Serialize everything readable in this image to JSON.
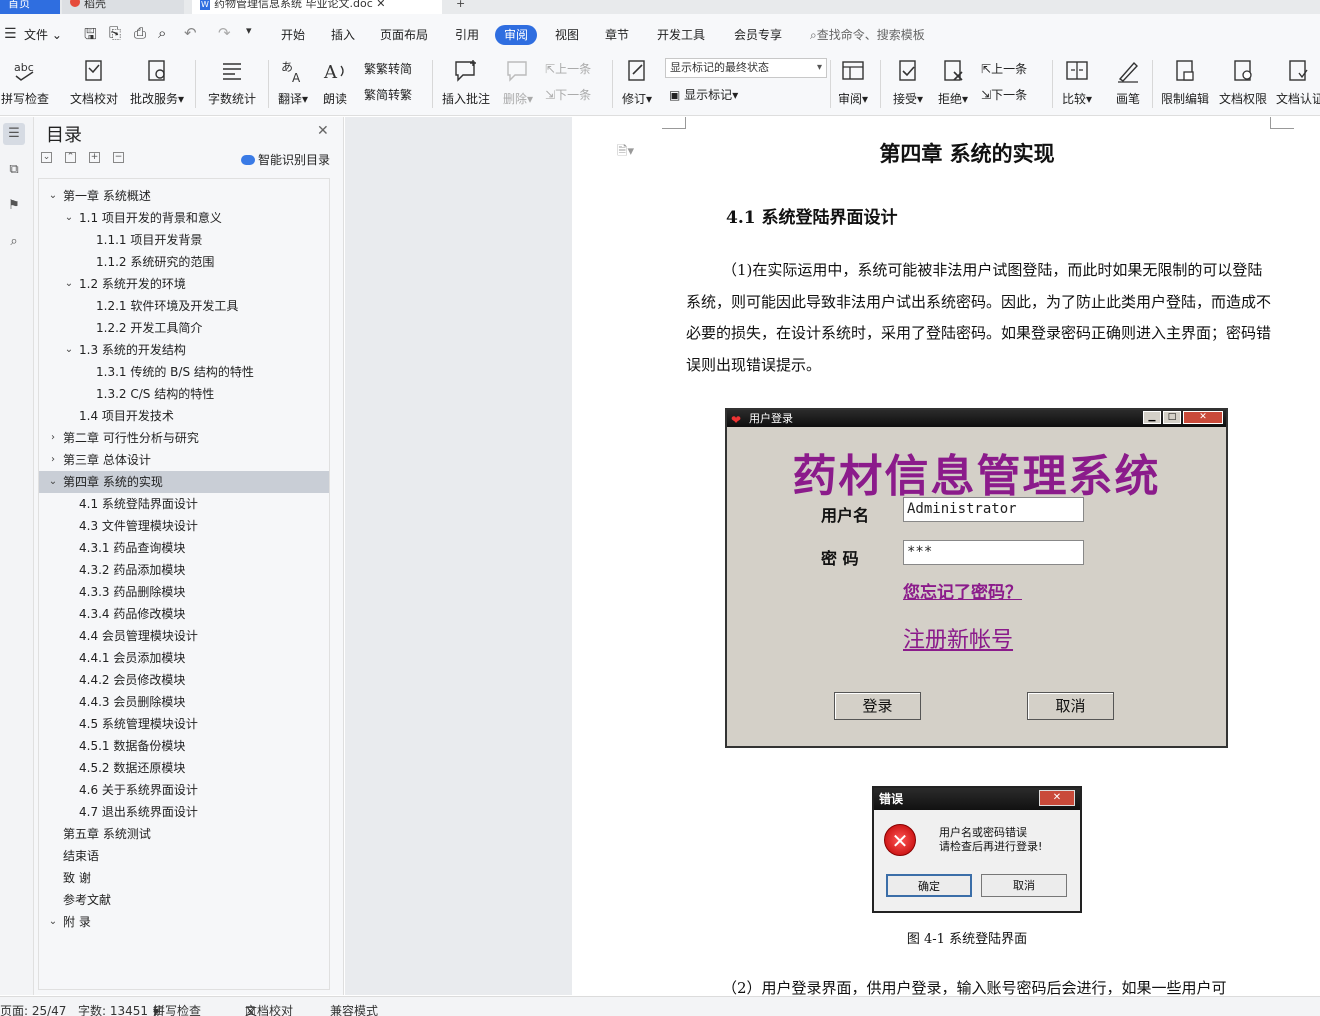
{
  "tabs": {
    "home": "首页",
    "dake": "稻壳",
    "document": "药物管理信息系统 毕业论文.doc"
  },
  "menu": {
    "file": "文件",
    "tabs": [
      "开始",
      "插入",
      "页面布局",
      "引用",
      "审阅",
      "视图",
      "章节",
      "开发工具",
      "会员专享"
    ],
    "active_tab": "审阅",
    "search_placeholder": "查找命令、搜索模板"
  },
  "ribbon": {
    "spell_check": "拼写检查",
    "doc_proof": "文档校对",
    "batch_service": "批改服务",
    "word_count": "字数统计",
    "translate": "翻译",
    "read_aloud": "朗读",
    "trad_to_simp": "繁转简",
    "simp_to_trad": "简转繁",
    "insert_comment": "插入批注",
    "delete": "删除",
    "prev": "上一条",
    "next": "下一条",
    "track_changes": "修订",
    "markup_select": "显示标记的最终状态",
    "show_markup": "显示标记",
    "review": "审阅",
    "accept": "接受",
    "reject": "拒绝",
    "prev_change": "上一条",
    "next_change": "下一条",
    "compare": "比较",
    "pen": "画笔",
    "restrict_edit": "限制编辑",
    "doc_permission": "文档权限",
    "doc_cert": "文档认证"
  },
  "toc": {
    "title": "目录",
    "smart": "智能识别目录",
    "items": [
      {
        "text": "第一章  系统概述",
        "level": 0,
        "arrow": "v"
      },
      {
        "text": "1.1  项目开发的背景和意义",
        "level": 1,
        "arrow": "v"
      },
      {
        "text": "1.1.1  项目开发背景",
        "level": 2,
        "arrow": ""
      },
      {
        "text": "1.1.2  系统研究的范围",
        "level": 2,
        "arrow": ""
      },
      {
        "text": "1.2  系统开发的环境",
        "level": 1,
        "arrow": "v"
      },
      {
        "text": "1.2.1  软件环境及开发工具",
        "level": 2,
        "arrow": ""
      },
      {
        "text": "1.2.2  开发工具简介",
        "level": 2,
        "arrow": ""
      },
      {
        "text": "1.3  系统的开发结构",
        "level": 1,
        "arrow": "v"
      },
      {
        "text": "1.3.1  传统的 B/S 结构的特性",
        "level": 2,
        "arrow": ""
      },
      {
        "text": "1.3.2 C/S  结构的特性",
        "level": 2,
        "arrow": ""
      },
      {
        "text": "1.4  项目开发技术",
        "level": 1,
        "arrow": ""
      },
      {
        "text": "第二章  可行性分析与研究",
        "level": 0,
        "arrow": ">"
      },
      {
        "text": "第三章  总体设计",
        "level": 0,
        "arrow": ">"
      },
      {
        "text": "第四章  系统的实现",
        "level": 0,
        "arrow": "v",
        "selected": true
      },
      {
        "text": "4.1  系统登陆界面设计",
        "level": 1,
        "arrow": ""
      },
      {
        "text": "4.3  文件管理模块设计",
        "level": 1,
        "arrow": ""
      },
      {
        "text": "4.3.1  药品查询模块",
        "level": 1,
        "arrow": ""
      },
      {
        "text": "4.3.2  药品添加模块",
        "level": 1,
        "arrow": ""
      },
      {
        "text": "4.3.3 药品删除模块",
        "level": 1,
        "arrow": ""
      },
      {
        "text": "4.3.4 药品修改模块",
        "level": 1,
        "arrow": ""
      },
      {
        "text": "4.4 会员管理模块设计",
        "level": 1,
        "arrow": ""
      },
      {
        "text": "4.4.1 会员添加模块",
        "level": 1,
        "arrow": ""
      },
      {
        "text": "4.4.2 会员修改模块",
        "level": 1,
        "arrow": ""
      },
      {
        "text": "4.4.3 会员删除模块",
        "level": 1,
        "arrow": ""
      },
      {
        "text": "4.5  系统管理模块设计",
        "level": 1,
        "arrow": ""
      },
      {
        "text": "4.5.1  数据备份模块",
        "level": 1,
        "arrow": ""
      },
      {
        "text": "4.5.2  数据还原模块",
        "level": 1,
        "arrow": ""
      },
      {
        "text": "4.6  关于系统界面设计",
        "level": 1,
        "arrow": ""
      },
      {
        "text": "4.7  退出系统界面设计",
        "level": 1,
        "arrow": ""
      },
      {
        "text": "第五章  系统测试",
        "level": 0,
        "arrow": ""
      },
      {
        "text": "结束语",
        "level": 0,
        "arrow": ""
      },
      {
        "text": "致   谢",
        "level": 0,
        "arrow": ""
      },
      {
        "text": "参考文献",
        "level": 0,
        "arrow": ""
      },
      {
        "text": "附   录",
        "level": 0,
        "arrow": "v"
      }
    ]
  },
  "document": {
    "chapter_title": "第四章  系统的实现",
    "section_title": "4.1  系统登陆界面设计",
    "para1": "（1)在实际运用中，系统可能被非法用户试图登陆，而此时如果无限制的可以登陆系统，则可能因此导致非法用户试出系统密码。因此，为了防止此类用户登陆，而造成不必要的损失，在设计系统时，采用了登陆密码。如果登录密码正确则进入主界面；密码错误则出现错误提示。",
    "para2": "（2）用户登录界面，供用户登录，输入账号密码后会进行，如果一些用户可",
    "caption": "图 4-1  系统登陆界面"
  },
  "login_window": {
    "title": "用户登录",
    "app_title": "药材信息管理系统",
    "username_label": "用户名",
    "username_value": "Administrator",
    "password_label": "密   码",
    "password_value": "***",
    "forgot": "您忘记了密码？",
    "register": "注册新帐号",
    "login_button": "登录",
    "cancel_button": "取消"
  },
  "error_dialog": {
    "title": "错误",
    "line1": "用户名或密码错误",
    "line2": "请检查后再进行登录!",
    "ok": "确定",
    "cancel": "取消"
  },
  "status": {
    "page": "页面: 25/47",
    "words": "字数: 13451",
    "spell": "拼写检查",
    "proof": "文档校对",
    "compat": "兼容模式"
  }
}
